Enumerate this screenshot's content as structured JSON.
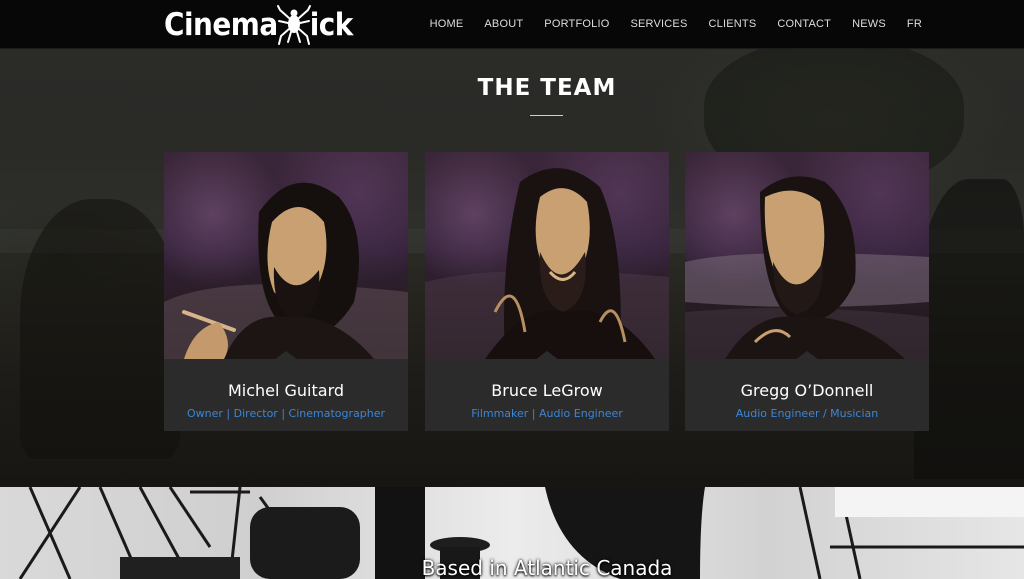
{
  "header": {
    "logo_text_left": "Cinema",
    "logo_text_right": "ick",
    "logo_mark": "tick-icon",
    "nav": [
      "HOME",
      "ABOUT",
      "PORTFOLIO",
      "SERVICES",
      "CLIENTS",
      "CONTACT",
      "NEWS",
      "FR"
    ]
  },
  "team": {
    "title": "THE TEAM",
    "members": [
      {
        "name": "Michel Guitard",
        "role": "Owner | Director | Cinematographer"
      },
      {
        "name": "Bruce LeGrow",
        "role": "Filmmaker | Audio Engineer"
      },
      {
        "name": "Gregg O’Donnell",
        "role": "Audio Engineer / Musician"
      }
    ]
  },
  "banner": {
    "text": "Based in Atlantic Canada"
  },
  "colors": {
    "accent": "#3c86d6",
    "card_bg": "#2b2b2b",
    "header_bg": "#070707"
  }
}
